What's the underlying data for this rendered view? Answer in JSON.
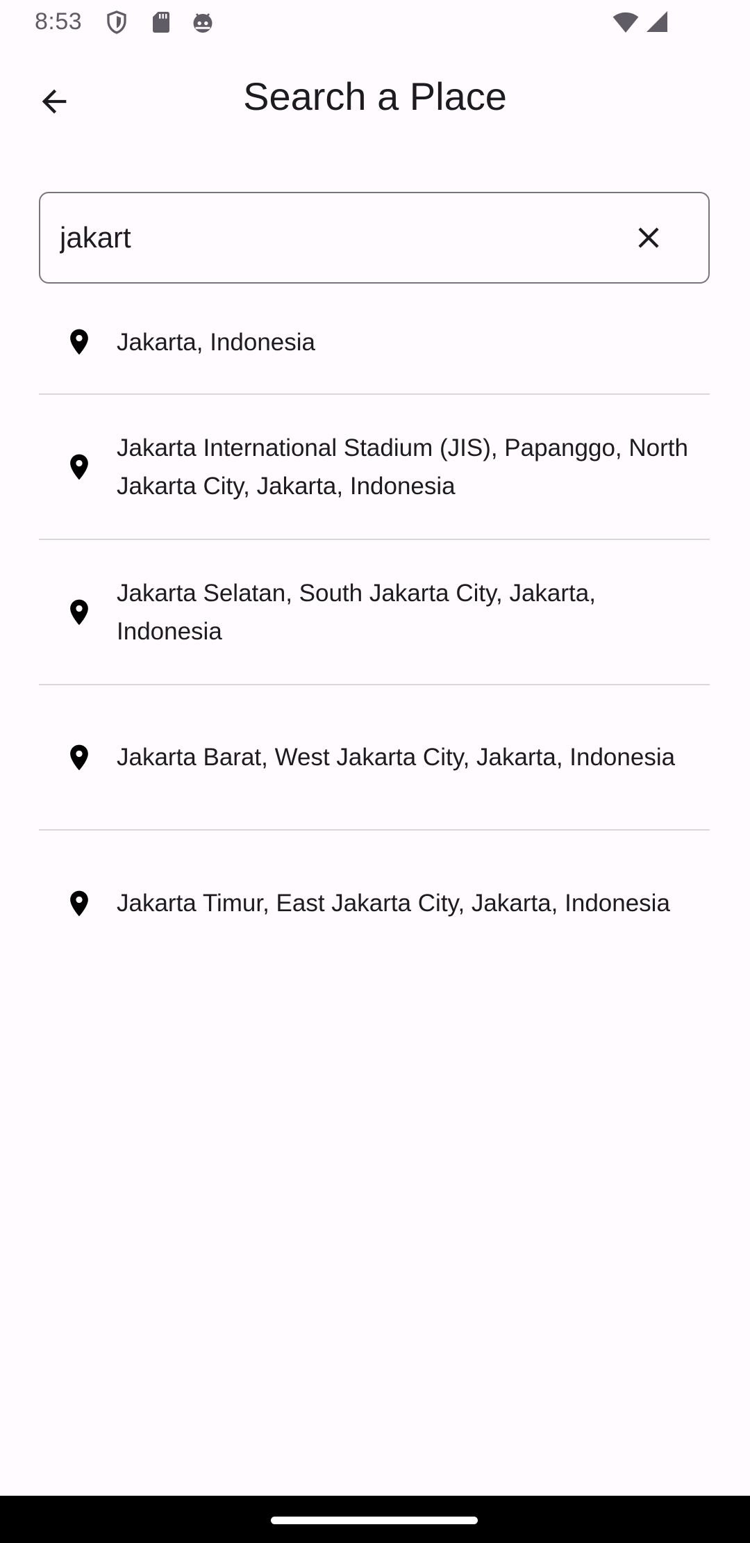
{
  "status_bar": {
    "time": "8:53",
    "icons_left": [
      "shield-icon",
      "sd-card-icon",
      "android-head-icon"
    ],
    "icons_right": [
      "wifi-icon",
      "cell-signal-icon"
    ]
  },
  "app_bar": {
    "title": "Search a Place",
    "back_icon": "arrow-back-icon"
  },
  "search": {
    "value": "jakart",
    "clear_icon": "close-icon"
  },
  "results": [
    {
      "text": "Jakarta, Indonesia"
    },
    {
      "text": "Jakarta International Stadium (JIS), Papanggo, North Jakarta City, Jakarta, Indonesia"
    },
    {
      "text": "Jakarta Selatan, South Jakarta City, Jakarta, Indonesia"
    },
    {
      "text": "Jakarta Barat, West Jakarta City, Jakarta, Indonesia"
    },
    {
      "text": "Jakarta Timur, East Jakarta City, Jakarta, Indonesia"
    }
  ],
  "colors": {
    "background": "#fffbfe",
    "text": "#1c1b1f",
    "outline": "#79747e",
    "divider": "#d9d6dc"
  }
}
